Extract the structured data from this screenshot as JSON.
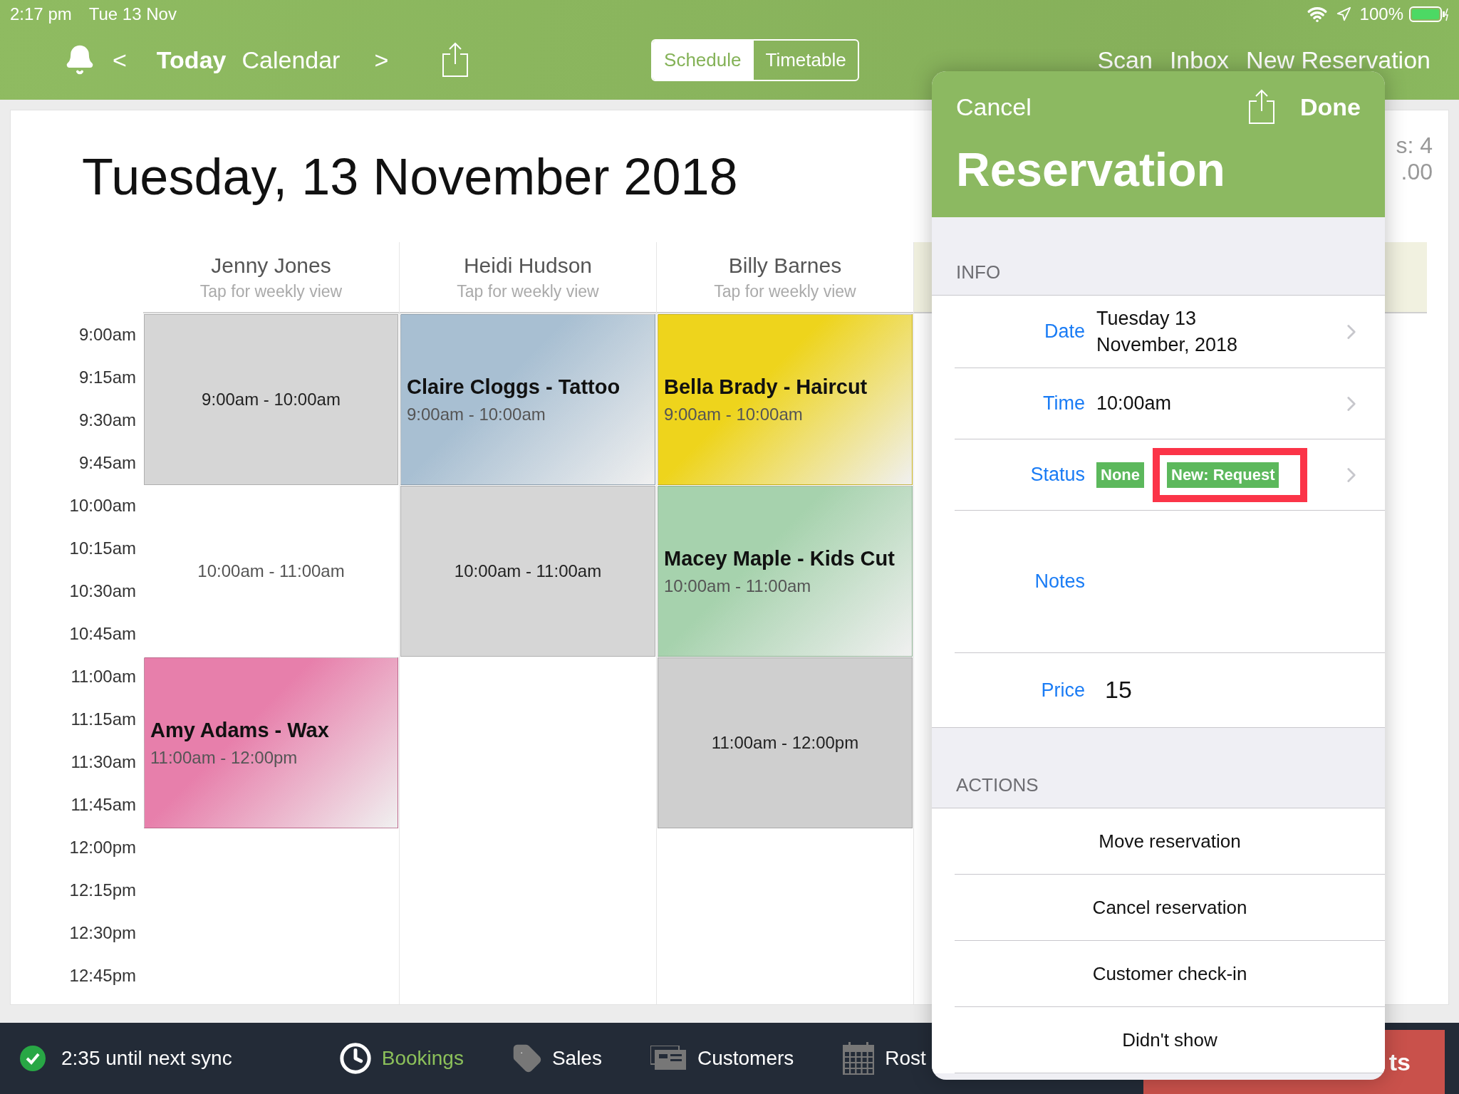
{
  "status_bar": {
    "time": "2:17 pm",
    "date": "Tue 13 Nov",
    "battery": "100%"
  },
  "nav": {
    "prev": "<",
    "today": "Today",
    "calendar": "Calendar",
    "next": ">",
    "segments": [
      {
        "label": "Schedule",
        "selected": true
      },
      {
        "label": "Timetable",
        "selected": false
      }
    ],
    "actions": [
      "Scan",
      "Inbox",
      "New Reservation"
    ]
  },
  "calendar": {
    "title": "Tuesday, 13 November 2018",
    "summary": [
      "s: 4",
      ".00"
    ],
    "times": [
      "9:00am",
      "9:15am",
      "9:30am",
      "9:45am",
      "10:00am",
      "10:15am",
      "10:30am",
      "10:45am",
      "11:00am",
      "11:15am",
      "11:30am",
      "11:45am",
      "12:00pm",
      "12:15pm",
      "12:30pm",
      "12:45pm"
    ],
    "columns": [
      {
        "name": "Jenny Jones",
        "subtitle": "Tap for weekly view",
        "events": [
          {
            "kind": "blocked",
            "time": "9:00am - 10:00am",
            "color": "#d6d6d6"
          },
          {
            "kind": "open",
            "time": "10:00am - 11:00am",
            "color": "#ffffff"
          },
          {
            "kind": "booked",
            "title": "Amy Adams - Wax",
            "time": "11:00am - 12:00pm",
            "color": "#e77fab"
          }
        ]
      },
      {
        "name": "Heidi Hudson",
        "subtitle": "Tap for weekly view",
        "events": [
          {
            "kind": "booked",
            "title": "Claire Cloggs - Tattoo",
            "time": "9:00am - 10:00am",
            "color": "#a8bfd2"
          },
          {
            "kind": "blocked",
            "time": "10:00am - 11:00am",
            "color": "#d6d6d6"
          }
        ]
      },
      {
        "name": "Billy Barnes",
        "subtitle": "Tap for weekly view",
        "events": [
          {
            "kind": "booked",
            "title": "Bella Brady - Haircut",
            "time": "9:00am - 10:00am",
            "color": "#eed41c"
          },
          {
            "kind": "booked",
            "title": "Macey Maple - Kids Cut",
            "time": "10:00am - 11:00am",
            "color": "#a6d2ad"
          },
          {
            "kind": "blocked",
            "time": "11:00am - 12:00pm",
            "color": "#cfcfcf"
          }
        ]
      }
    ]
  },
  "popover": {
    "cancel": "Cancel",
    "done": "Done",
    "title": "Reservation",
    "info_header": "INFO",
    "rows": [
      {
        "kind": "text",
        "label": "Date",
        "value": "Tuesday 13\nNovember, 2018"
      },
      {
        "kind": "text",
        "label": "Time",
        "value": "10:00am"
      },
      {
        "kind": "badges",
        "label": "Status",
        "badges": [
          {
            "label": "None",
            "highlighted": false
          },
          {
            "label": "New: Request",
            "highlighted": true
          }
        ]
      },
      {
        "kind": "notes",
        "label": "Notes"
      },
      {
        "kind": "price",
        "label": "Price",
        "value": "15"
      }
    ],
    "actions_header": "ACTIONS",
    "actions": [
      "Move reservation",
      "Cancel reservation",
      "Customer check-in",
      "Didn't show"
    ]
  },
  "bottom_bar": {
    "sync": "2:35 until next sync",
    "tabs": [
      {
        "label": "Bookings",
        "selected": true
      },
      {
        "label": "Sales",
        "selected": false
      },
      {
        "label": "Customers",
        "selected": false
      },
      {
        "label": "Rost",
        "selected": false
      }
    ],
    "button": "ts"
  }
}
